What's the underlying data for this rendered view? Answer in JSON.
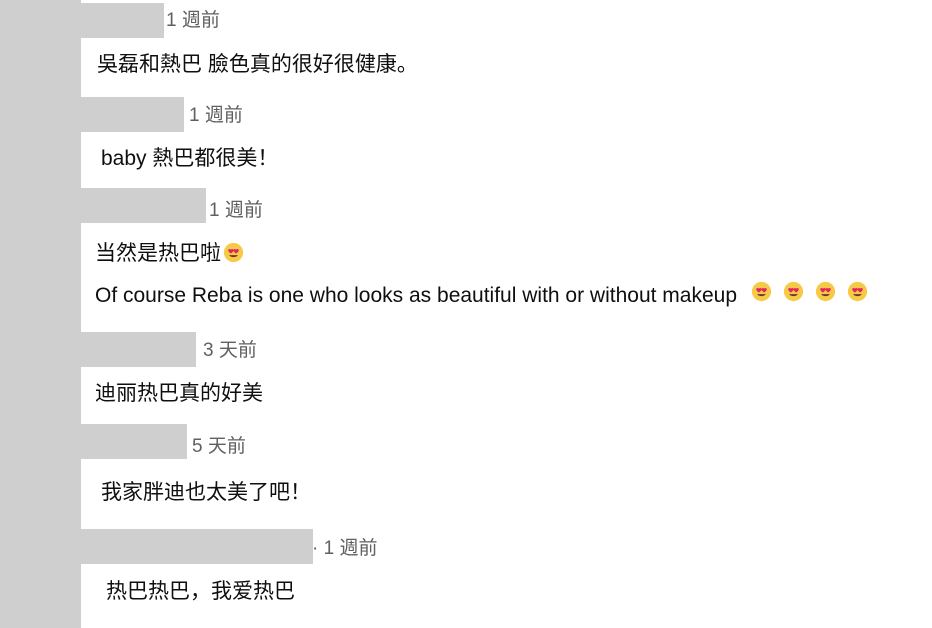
{
  "comments": [
    {
      "timestamp": "1 週前",
      "lines": [
        "吳磊和熱巴 臉色真的很好很健康。"
      ]
    },
    {
      "timestamp": "1 週前",
      "lines": [
        "baby 熱巴都很美！"
      ]
    },
    {
      "timestamp": "1 週前",
      "lines": [
        "当然是热巴啦",
        "Of course Reba is one who looks as beautiful with or without makeup"
      ],
      "emoji": "heart-eyes-emoji"
    },
    {
      "timestamp": "3 天前",
      "lines": [
        "迪丽热巴真的好美"
      ]
    },
    {
      "timestamp": "5 天前",
      "lines": [
        "我家胖迪也太美了吧！"
      ]
    },
    {
      "timestamp": "· 1 週前",
      "lines": [
        "热巴热巴，我爱热巴"
      ]
    }
  ]
}
